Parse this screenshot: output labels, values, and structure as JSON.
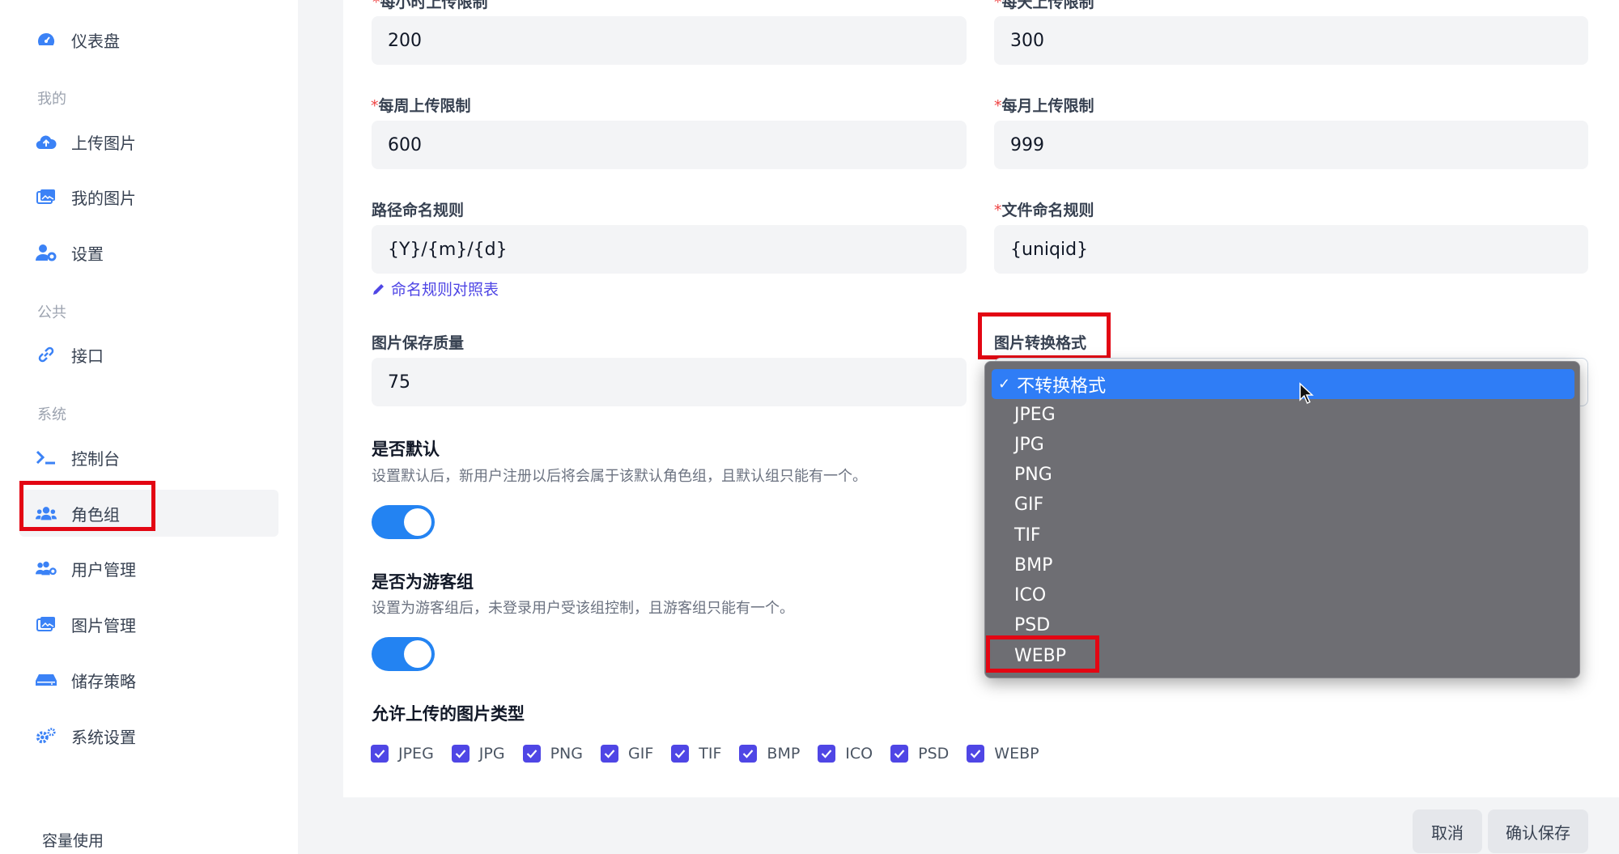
{
  "sidebar": {
    "items": [
      {
        "label": "仪表盘",
        "icon": "dashboard-icon"
      },
      {
        "label": "上传图片",
        "icon": "cloud-upload-icon"
      },
      {
        "label": "我的图片",
        "icon": "images-icon"
      },
      {
        "label": "设置",
        "icon": "user-gear-icon"
      },
      {
        "label": "接口",
        "icon": "link-icon"
      },
      {
        "label": "控制台",
        "icon": "terminal-icon"
      },
      {
        "label": "角色组",
        "icon": "users-icon"
      },
      {
        "label": "用户管理",
        "icon": "users-gear-icon"
      },
      {
        "label": "图片管理",
        "icon": "images-icon"
      },
      {
        "label": "储存策略",
        "icon": "hdd-icon"
      },
      {
        "label": "系统设置",
        "icon": "gears-icon"
      }
    ],
    "sections": {
      "mine": "我的",
      "public": "公共",
      "system": "系统"
    },
    "footer": "容量使用"
  },
  "form": {
    "hourly_label": "每小时上传限制",
    "hourly_value": "200",
    "daily_label": "每天上传限制",
    "daily_value": "300",
    "weekly_label": "每周上传限制",
    "weekly_value": "600",
    "monthly_label": "每月上传限制",
    "monthly_value": "999",
    "path_rule_label": "路径命名规则",
    "path_rule_value": "{Y}/{m}/{d}",
    "file_rule_label": "文件命名规则",
    "file_rule_value": "{uniqid}",
    "naming_link": "命名规则对照表",
    "quality_label": "图片保存质量",
    "quality_value": "75",
    "convert_label": "图片转换格式",
    "default_heading": "是否默认",
    "default_desc": "设置默认后，新用户注册以后将会属于该默认角色组，且默认组只能有一个。",
    "default_on": true,
    "guest_heading": "是否为游客组",
    "guest_desc": "设置为游客组后，未登录用户受该组控制，且游客组只能有一个。",
    "guest_on": true,
    "types_heading": "允许上传的图片类型",
    "types": [
      "JPEG",
      "JPG",
      "PNG",
      "GIF",
      "TIF",
      "BMP",
      "ICO",
      "PSD",
      "WEBP"
    ]
  },
  "dropdown": {
    "selected": "不转换格式",
    "options": [
      "JPEG",
      "JPG",
      "PNG",
      "GIF",
      "TIF",
      "BMP",
      "ICO",
      "PSD",
      "WEBP"
    ]
  },
  "buttons": {
    "cancel": "取消",
    "save": "确认保存"
  },
  "colors": {
    "accent": "#4f46e5",
    "toggle": "#2383f2",
    "highlight": "#e30613",
    "dropdown_bg": "#6e6e73",
    "dropdown_selected": "#2f7df6"
  }
}
